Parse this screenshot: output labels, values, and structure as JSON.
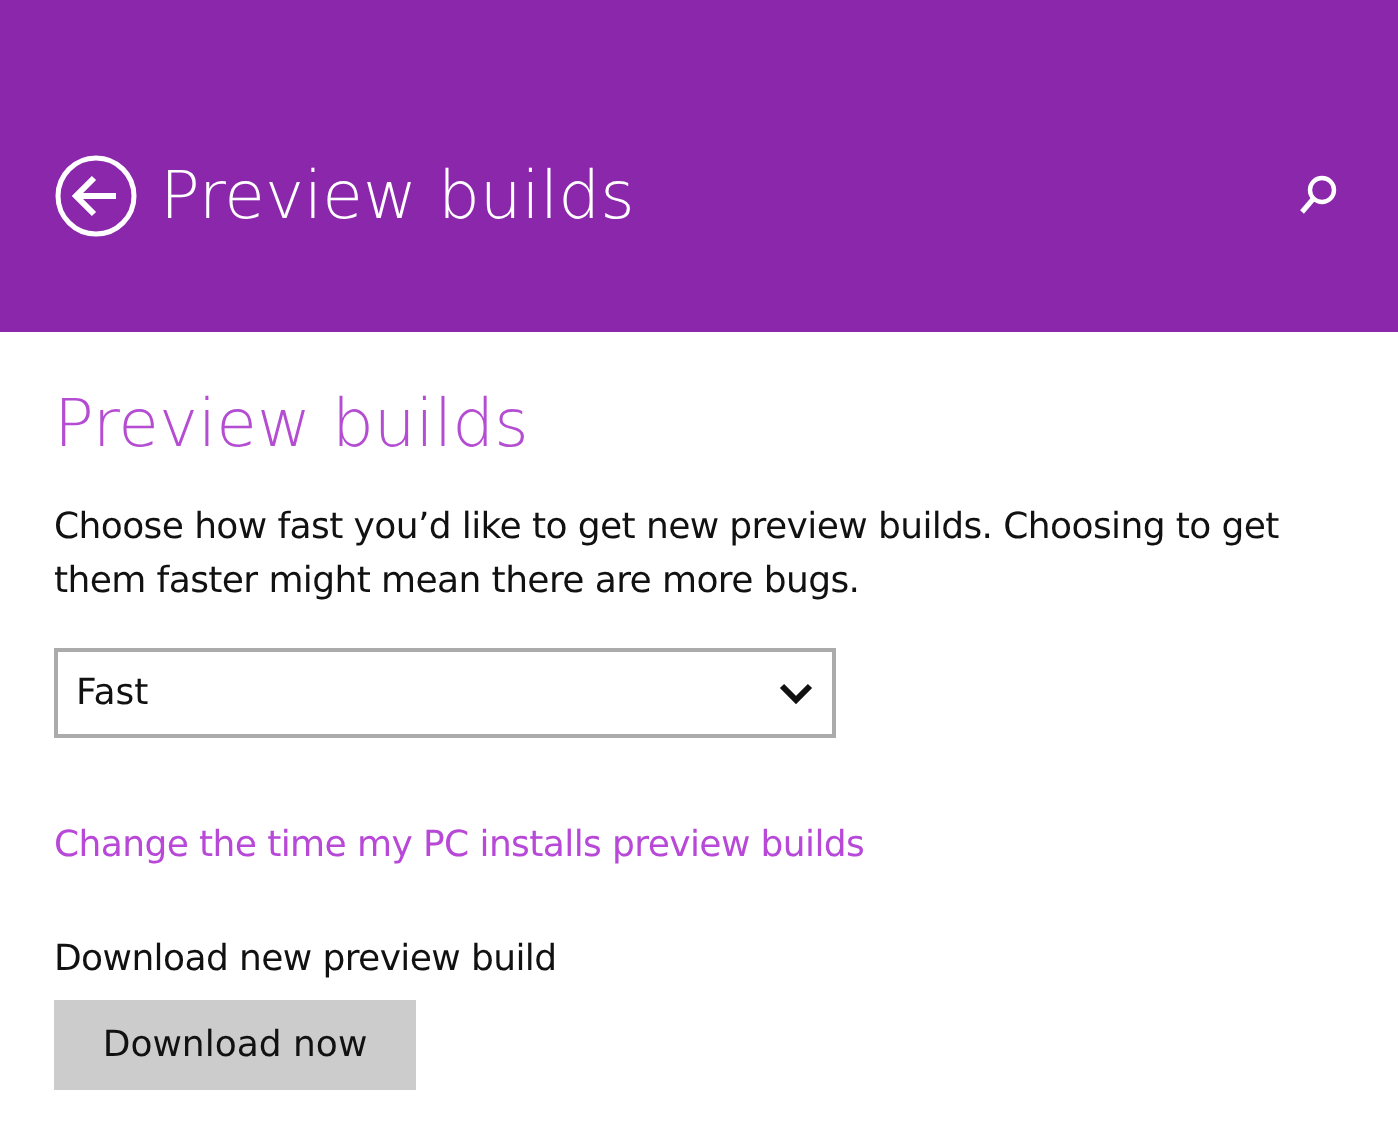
{
  "header": {
    "title": "Preview builds"
  },
  "section_title": "Preview builds",
  "description": "Choose how fast you’d like to get new preview builds. Choosing to get them faster might mean there are more bugs.",
  "speed_dropdown": {
    "value": "Fast"
  },
  "schedule_link": "Change the time my PC installs preview builds",
  "download_label": "Download new preview build",
  "download_button": "Download now"
}
